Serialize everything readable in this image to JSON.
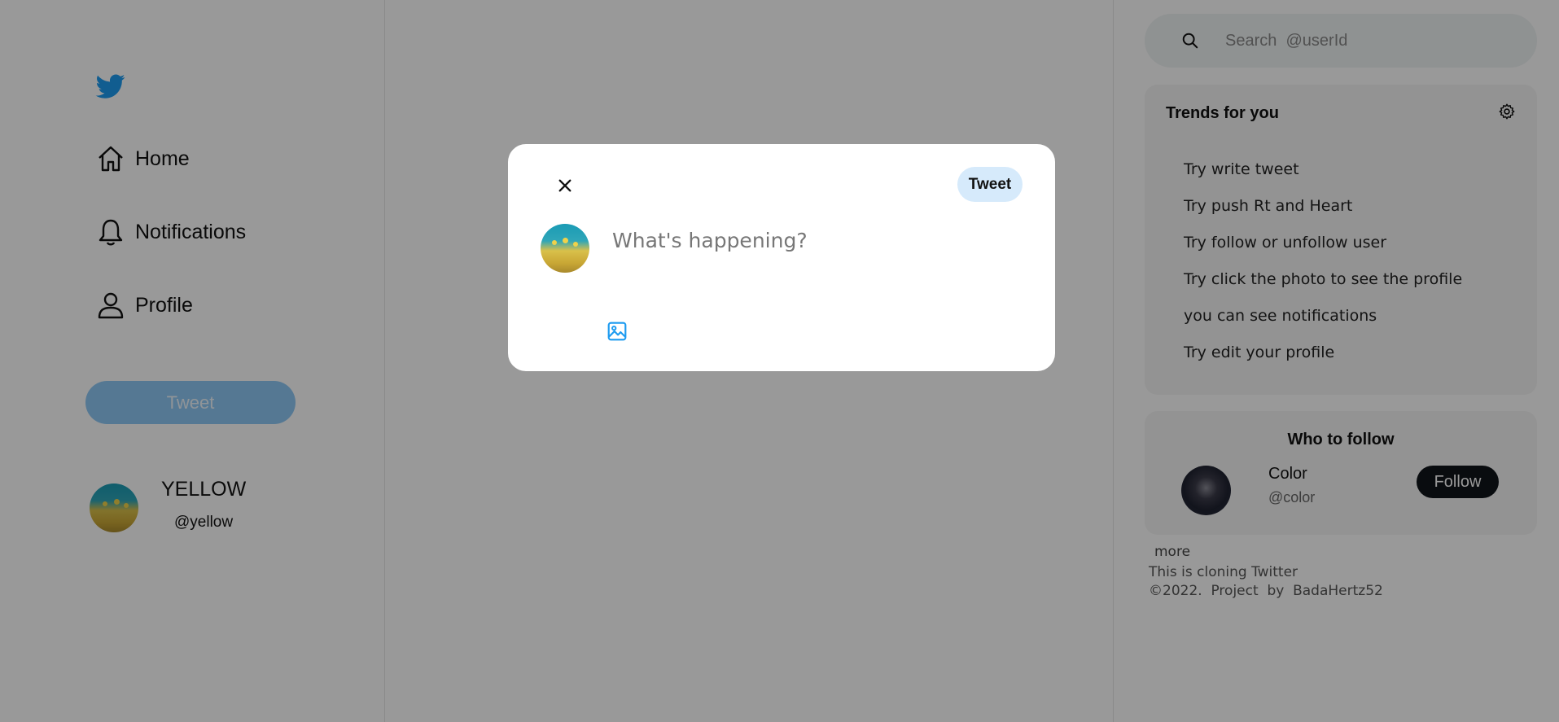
{
  "app": {
    "brand_color": "#1d9bf0"
  },
  "nav": {
    "items": [
      {
        "label": "Home",
        "icon": "home-icon"
      },
      {
        "label": "Notifications",
        "icon": "bell-icon"
      },
      {
        "label": "Profile",
        "icon": "user-icon"
      }
    ],
    "tweet_label": "Tweet"
  },
  "me": {
    "name": "YELLOW",
    "handle": "@yellow"
  },
  "search": {
    "placeholder": "Search  @userId",
    "icon": "search-icon"
  },
  "trends": {
    "title": "Trends for you",
    "items": [
      "Try write tweet",
      "Try push Rt and Heart",
      "Try follow or unfollow user",
      "Try click the photo to see the profile",
      "you can see notifications",
      "Try edit your profile"
    ]
  },
  "who_to_follow": {
    "title": "Who to follow",
    "user": {
      "name": "Color",
      "handle": "@color"
    },
    "follow_label": "Follow"
  },
  "footer": {
    "more": "more",
    "line1": "This is cloning Twitter",
    "line2": "©2022.  Project  by  BadaHertz52"
  },
  "modal": {
    "tweet_label": "Tweet",
    "compose_placeholder": "What's happening?",
    "colors": {
      "tweet_button_bg": "#d6eafb",
      "overlay": "rgba(0,0,0,0.4)"
    }
  }
}
